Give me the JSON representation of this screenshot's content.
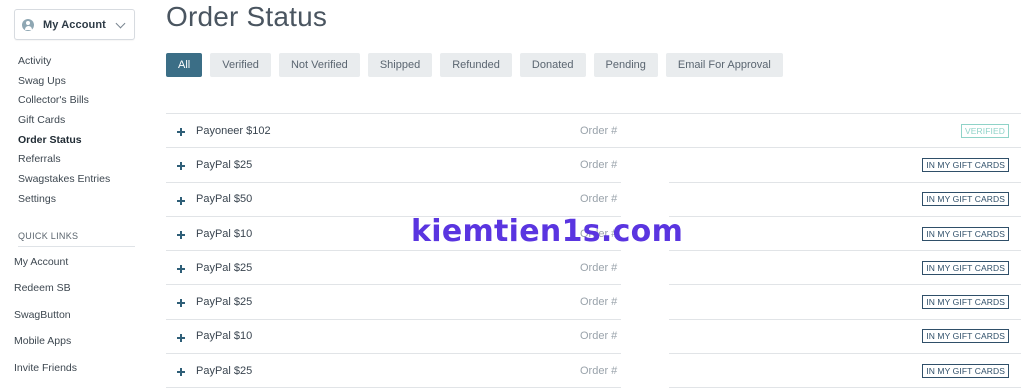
{
  "account": {
    "label": "My Account",
    "icon": "user-avatar-icon"
  },
  "nav": [
    {
      "label": "Activity",
      "active": false
    },
    {
      "label": "Swag Ups",
      "active": false
    },
    {
      "label": "Collector's Bills",
      "active": false
    },
    {
      "label": "Gift Cards",
      "active": false
    },
    {
      "label": "Order Status",
      "active": true
    },
    {
      "label": "Referrals",
      "active": false
    },
    {
      "label": "Swagstakes Entries",
      "active": false
    },
    {
      "label": "Settings",
      "active": false
    }
  ],
  "quick_links": {
    "heading": "QUICK LINKS",
    "items": [
      "My Account",
      "Redeem SB",
      "SwagButton",
      "Mobile Apps",
      "Invite Friends"
    ]
  },
  "page_title": "Order Status",
  "filters": [
    "All",
    "Verified",
    "Not Verified",
    "Shipped",
    "Refunded",
    "Donated",
    "Pending",
    "Email For Approval"
  ],
  "orders": [
    {
      "name": "Payoneer $102",
      "order": "Order #",
      "status": "VERIFIED"
    },
    {
      "name": "PayPal $25",
      "order": "Order #",
      "status": "IN MY GIFT CARDS"
    },
    {
      "name": "PayPal $50",
      "order": "Order #",
      "status": "IN MY GIFT CARDS"
    },
    {
      "name": "PayPal $10",
      "order": "Order #",
      "status": "IN MY GIFT CARDS"
    },
    {
      "name": "PayPal $25",
      "order": "Order #",
      "status": "IN MY GIFT CARDS"
    },
    {
      "name": "PayPal $25",
      "order": "Order #",
      "status": "IN MY GIFT CARDS"
    },
    {
      "name": "PayPal $10",
      "order": "Order #",
      "status": "IN MY GIFT CARDS"
    },
    {
      "name": "PayPal $25",
      "order": "Order #",
      "status": "IN MY GIFT CARDS"
    }
  ],
  "watermark": "kiemtien1s.com",
  "colors": {
    "accent": "#3b6e86",
    "badge_border": "#2f4f69",
    "verified_badge": "#8fd3c8",
    "watermark": "#5a35e0"
  }
}
